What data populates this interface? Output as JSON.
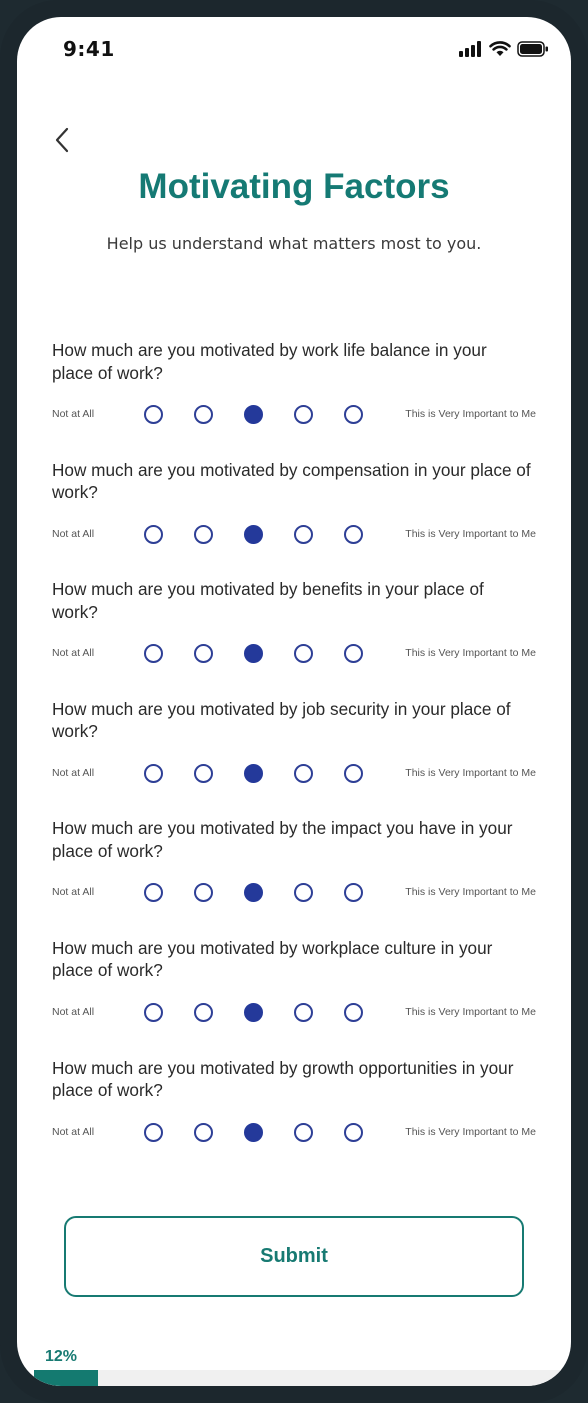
{
  "status_bar": {
    "time": "9:41"
  },
  "header": {
    "title": "Motivating Factors",
    "subtitle": "Help us understand what matters most to you."
  },
  "scale": {
    "low_label": "Not at All",
    "high_label": "This is Very Important to Me",
    "options_count": 5
  },
  "questions": [
    {
      "text": "How much are you motivated by work life balance in your place of work?",
      "selected": 2
    },
    {
      "text": "How much are you motivated by compensation in your place of work?",
      "selected": 2
    },
    {
      "text": "How much are you motivated by benefits in your place of work?",
      "selected": 2
    },
    {
      "text": "How much are you motivated by job security in your place of work?",
      "selected": 2
    },
    {
      "text": "How much are you motivated by the impact you have in your place of work?",
      "selected": 2
    },
    {
      "text": "How much are you motivated by workplace culture in your place of work?",
      "selected": 2
    },
    {
      "text": "How much are you motivated by growth opportunities in your place of work?",
      "selected": 2
    }
  ],
  "submit": {
    "label": "Submit"
  },
  "progress": {
    "label": "12%",
    "value": 0.12
  },
  "colors": {
    "accent": "#157a74",
    "radio": "#24399a"
  },
  "icons": {
    "back": "chevron-left-icon"
  }
}
